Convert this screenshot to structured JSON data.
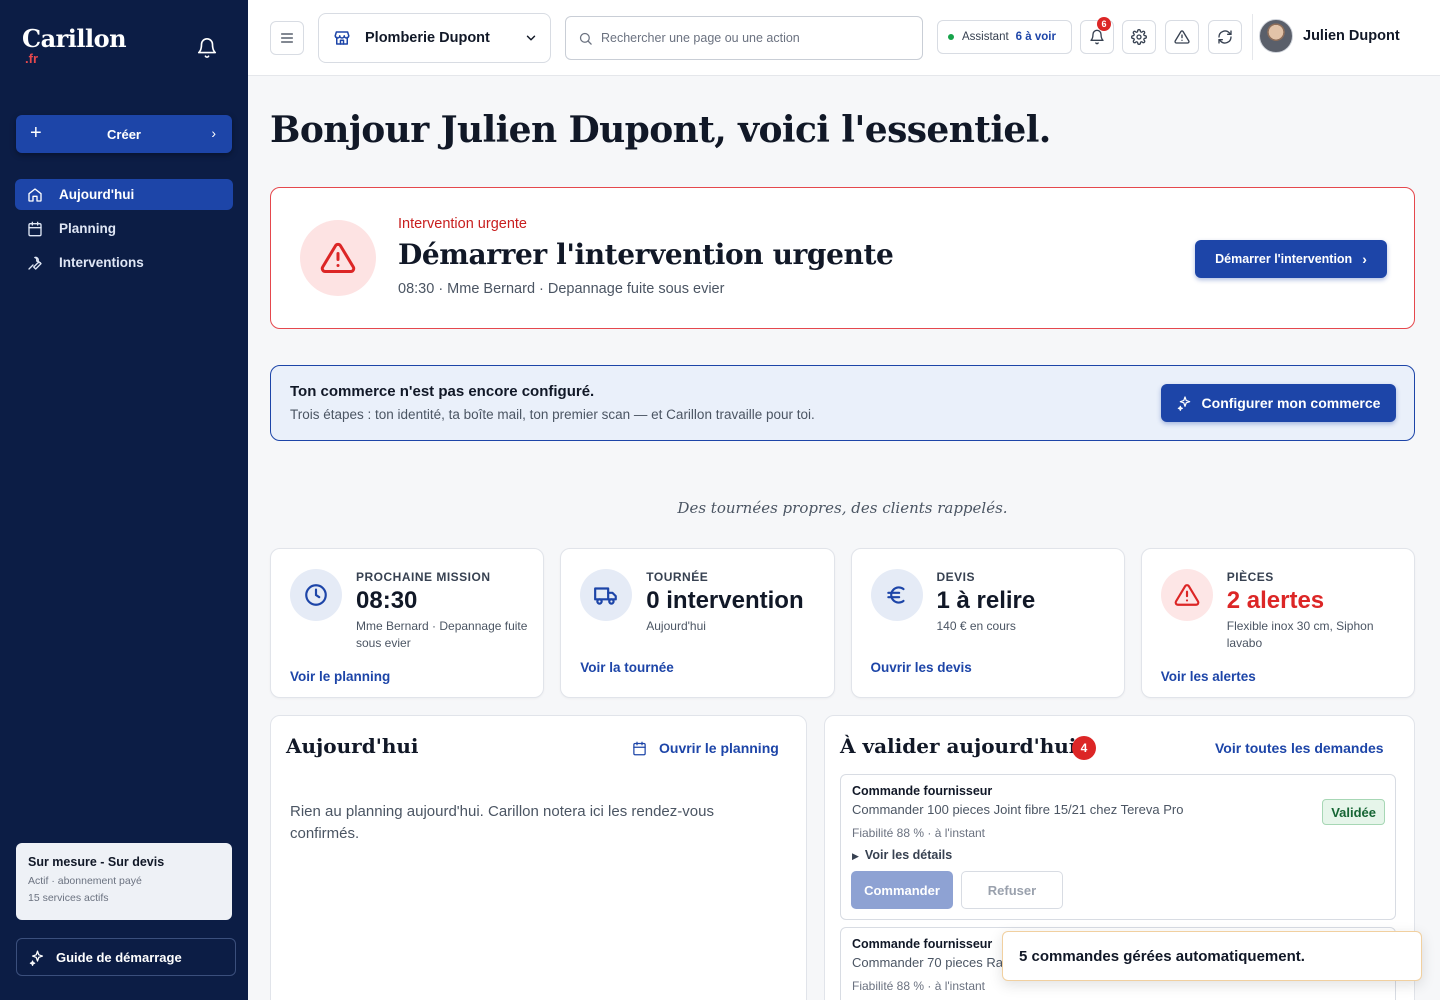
{
  "brand": {
    "name": "Carillon",
    "tld": ".fr"
  },
  "sidebar": {
    "create_label": "Créer",
    "items": [
      {
        "label": "Aujourd'hui",
        "icon": "home-icon",
        "active": true
      },
      {
        "label": "Planning",
        "icon": "calendar-icon",
        "active": false
      },
      {
        "label": "Interventions",
        "icon": "wrench-icon",
        "active": false
      }
    ],
    "plan": {
      "title": "Sur mesure - Sur devis",
      "status": "Actif · abonnement payé",
      "services": "15 services actifs"
    },
    "guide_label": "Guide de démarrage"
  },
  "topbar": {
    "shop_name": "Plomberie Dupont",
    "search_placeholder": "Rechercher une page ou une action",
    "assistant_label": "Assistant",
    "assistant_count": "6 à voir",
    "notifications_count": "6",
    "user_name": "Julien Dupont"
  },
  "greeting": "Bonjour Julien Dupont, voici l'essentiel.",
  "urgent": {
    "kicker": "Intervention urgente",
    "title": "Démarrer l'intervention urgente",
    "meta": "08:30 · Mme Bernard · Depannage fuite sous evier",
    "button": "Démarrer l'intervention"
  },
  "setup": {
    "title": "Ton commerce n'est pas encore configuré.",
    "subtitle": "Trois étapes : ton identité, ta boîte mail, ton premier scan — et Carillon travaille pour toi.",
    "button": "Configurer mon commerce"
  },
  "tagline": "Des tournées propres, des clients rappelés.",
  "stats": [
    {
      "label": "PROCHAINE MISSION",
      "value": "08:30",
      "sub": "Mme Bernard · Depannage fuite sous evier",
      "link": "Voir le planning",
      "icon": "clock-icon",
      "alert": false
    },
    {
      "label": "TOURNÉE",
      "value": "0 intervention",
      "sub": "Aujourd'hui",
      "link": "Voir la tournée",
      "icon": "truck-icon",
      "alert": false
    },
    {
      "label": "DEVIS",
      "value": "1 à relire",
      "sub": "140 € en cours",
      "link": "Ouvrir les devis",
      "icon": "euro-icon",
      "alert": false
    },
    {
      "label": "PIÈCES",
      "value": "2 alertes",
      "sub": "Flexible inox 30 cm, Siphon lavabo",
      "link": "Voir les alertes",
      "icon": "warning-icon",
      "alert": true
    }
  ],
  "today": {
    "title": "Aujourd'hui",
    "link": "Ouvrir le planning",
    "empty": "Rien au planning aujourd'hui. Carillon notera ici les rendez-vous confirmés."
  },
  "validate": {
    "title": "À valider aujourd'hui",
    "count": "4",
    "link": "Voir toutes les demandes",
    "requests": [
      {
        "type": "Commande fournisseur",
        "desc": "Commander 100 pieces Joint fibre 15/21 chez Tereva Pro",
        "reliability": "Fiabilité 88 % · à l'instant",
        "details": "Voir les détails",
        "status": "Validée",
        "accept": "Commander",
        "refuse": "Refuser"
      },
      {
        "type": "Commande fournisseur",
        "desc": "Commander 70 pieces Ra",
        "reliability": "Fiabilité 88 % · à l'instant"
      }
    ]
  },
  "toast": "5 commandes gérées automatiquement."
}
